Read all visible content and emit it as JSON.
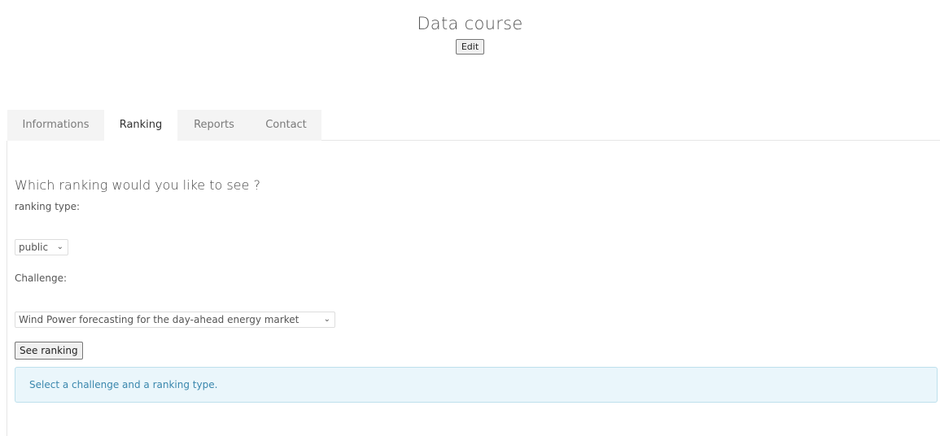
{
  "header": {
    "title": "Data course",
    "edit_label": "Edit"
  },
  "tabs": [
    {
      "label": "Informations",
      "active": false
    },
    {
      "label": "Ranking",
      "active": true
    },
    {
      "label": "Reports",
      "active": false
    },
    {
      "label": "Contact",
      "active": false
    }
  ],
  "ranking_form": {
    "question": "Which ranking would you like to see ?",
    "ranking_type_label": "ranking type:",
    "ranking_type_value": "public",
    "challenge_label": "Challenge:",
    "challenge_value": "Wind Power forecasting for the day-ahead energy market",
    "see_ranking_label": "See ranking",
    "info_message": "Select a challenge and a ranking type."
  },
  "icons": {
    "dropdown": "chevron-down-icon"
  },
  "colors": {
    "info_text": "#3a87ad",
    "info_background": "#eaf6fb",
    "info_border": "#bde0ec"
  }
}
